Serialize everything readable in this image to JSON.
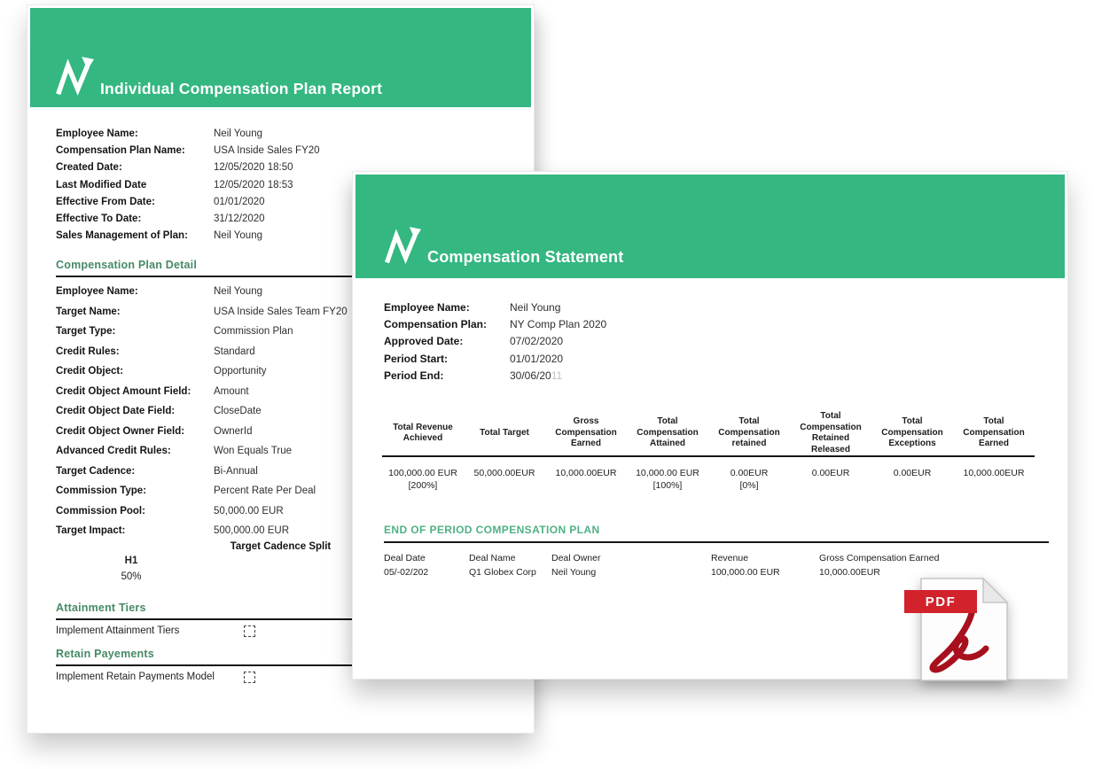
{
  "colors": {
    "header_green": "#34b781",
    "section_title_green": "#468a66",
    "eop_title_green": "#4fb184",
    "pdf_badge_red": "#d2222b",
    "acrobat_glyph_red": "#a8101d"
  },
  "report": {
    "title": "Individual Compensation Plan Report",
    "info": [
      {
        "label": "Employee Name:",
        "value": "Neil Young"
      },
      {
        "label": "Compensation Plan Name:",
        "value": "USA Inside Sales FY20"
      },
      {
        "label": "Created Date:",
        "value": "12/05/2020 18:50"
      },
      {
        "label": "Last Modified Date",
        "value": "12/05/2020 18:53"
      },
      {
        "label": "Effective From Date:",
        "value": "01/01/2020"
      },
      {
        "label": "Effective To Date:",
        "value": "31/12/2020"
      },
      {
        "label": "Sales Management of Plan:",
        "value": "Neil Young"
      }
    ],
    "plan_detail": {
      "title": "Compensation Plan Detail",
      "rows": [
        {
          "label": "Employee Name:",
          "value": "Neil Young"
        },
        {
          "label": "Target Name:",
          "value": "USA Inside Sales Team FY20"
        },
        {
          "label": "Target Type:",
          "value": "Commission Plan"
        },
        {
          "label": "Credit Rules:",
          "value": "Standard"
        },
        {
          "label": "Credit Object:",
          "value": "Opportunity"
        },
        {
          "label": "Credit Object Amount Field:",
          "value": "Amount"
        },
        {
          "label": "Credit Object Date Field:",
          "value": "CloseDate"
        },
        {
          "label": "Credit Object Owner Field:",
          "value": "OwnerId"
        },
        {
          "label": "Advanced Credit Rules:",
          "value": "Won Equals True"
        },
        {
          "label": "Target Cadence:",
          "value": "Bi-Annual"
        },
        {
          "label": "Commission Type:",
          "value": "Percent Rate Per Deal"
        },
        {
          "label": "Commission Pool:",
          "value": "50,000.00 EUR"
        },
        {
          "label": "Target Impact:",
          "value": "500,000.00 EUR"
        }
      ]
    },
    "cadence_split": {
      "title": "Target Cadence Split",
      "column": "H1",
      "value": "50%"
    },
    "attainment": {
      "title": "Attainment Tiers",
      "row_label": "Implement Attainment Tiers"
    },
    "retain": {
      "title": "Retain Payements",
      "row_label": "Implement Retain Payments Model"
    }
  },
  "statement": {
    "title": "Compensation Statement",
    "info": [
      {
        "label": "Employee Name:",
        "value": "Neil Young"
      },
      {
        "label": "Compensation Plan:",
        "value": "NY Comp Plan 2020"
      },
      {
        "label": "Approved Date:",
        "value": "07/02/2020"
      },
      {
        "label": "Period Start:",
        "value": "01/01/2020"
      },
      {
        "label": "Period End:",
        "value": "30/06/20"
      }
    ],
    "period_end_faint": "11",
    "summary_table": {
      "cells": [
        {
          "header": "Total Revenue\nAchieved",
          "value": "100,000.00 EUR",
          "sub": "[200%]"
        },
        {
          "header": "Total Target",
          "value": "50,000.00EUR",
          "sub": ""
        },
        {
          "header": "Gross\nCompensation\nEarned",
          "value": "10,000.00EUR",
          "sub": ""
        },
        {
          "header": "Total\nCompensation\nAttained",
          "value": "10,000.00 EUR",
          "sub": "[100%]"
        },
        {
          "header": "Total\nCompensation\nretained",
          "value": "0.00EUR",
          "sub": "[0%]"
        },
        {
          "header": "Total\nCompensation\nRetained Released",
          "value": "0.00EUR",
          "sub": ""
        },
        {
          "header": "Total\nCompensation\nExceptions",
          "value": "0.00EUR",
          "sub": ""
        },
        {
          "header": "Total\nCompensation\nEarned",
          "value": "10,000.00EUR",
          "sub": ""
        }
      ]
    },
    "eop": {
      "title": "END OF PERIOD COMPENSATION PLAN",
      "cells": [
        {
          "header": "Deal Date",
          "value": "05/-02/202"
        },
        {
          "header": "Deal Name",
          "value": "Q1 Globex Corp"
        },
        {
          "header": "Deal Owner",
          "value": "Neil Young"
        },
        {
          "header": "Revenue",
          "value": "100,000.00 EUR"
        },
        {
          "header": "Gross Compensation Earned",
          "value": "10,000.00EUR"
        }
      ]
    }
  },
  "pdf_icon": {
    "label": "PDF"
  }
}
